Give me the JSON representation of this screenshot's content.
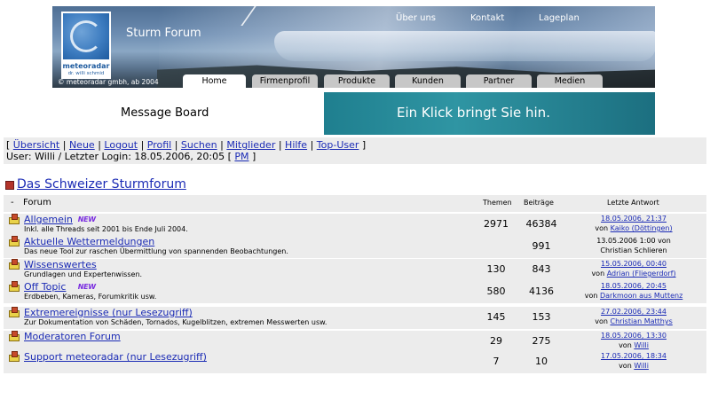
{
  "header": {
    "site_title": "Sturm Forum",
    "logo_name": "meteoradar",
    "logo_sub": "dr. willi schmid",
    "copyright": "© meteoradar gmbh, ab 2004",
    "top_links": [
      "Über uns",
      "Kontakt",
      "Lageplan"
    ],
    "tabs": [
      "Home",
      "Firmenprofil",
      "Produkte",
      "Kunden",
      "Partner",
      "Medien"
    ],
    "active_tab": "Home"
  },
  "subbanner": {
    "message_board": "Message Board",
    "ad_text": "Ein Klick bringt Sie hin."
  },
  "nav": {
    "links": [
      "Übersicht",
      "Neue",
      "Logout",
      "Profil",
      "Suchen",
      "Mitglieder",
      "Hilfe",
      "Top-User"
    ],
    "user_line": "User: Willi / Letzter Login: 18.05.2006, 20:05",
    "pm": "PM"
  },
  "forum": {
    "title": "Das Schweizer Sturmforum",
    "columns": {
      "minus": "-",
      "forum": "Forum",
      "themen": "Themen",
      "beitraege": "Beiträge",
      "letzte": "Letzte Antwort"
    },
    "new_badge": "NEW",
    "rows": [
      {
        "name": "Allgemein",
        "new": true,
        "desc": "Inkl. alle Threads seit 2001 bis Ende Juli 2004.",
        "themen": "2971",
        "beitraege": "46384",
        "last_date": "18.05.2006, 21:37",
        "last_date_link": true,
        "von": "von",
        "last_user": "Kaiko (Döttingen)",
        "last_user_link": true
      },
      {
        "name": "Aktuelle Wettermeldungen",
        "new": false,
        "desc": "Das neue Tool zur raschen Übermittlung von spannenden Beobachtungen.",
        "themen": "",
        "beitraege": "991",
        "last_date": "13.05.2006 1:00 von",
        "last_date_link": false,
        "von": "",
        "last_user": "Christian Schlieren",
        "last_user_link": false
      },
      {
        "name": "Wissenswertes",
        "new": false,
        "desc": "Grundlagen und Expertenwissen.",
        "themen": "130",
        "beitraege": "843",
        "last_date": "15.05.2006, 00:40",
        "last_date_link": true,
        "von": "von",
        "last_user": "Adrian (Fliegerdorf)",
        "last_user_link": true
      },
      {
        "name": "Off Topic",
        "new": true,
        "desc": "Erdbeben, Kameras, Forumkritik usw.",
        "themen": "580",
        "beitraege": "4136",
        "last_date": "18.05.2006, 20:45",
        "last_date_link": true,
        "von": "von",
        "last_user": "Darkmoon aus Muttenz",
        "last_user_link": true
      },
      {
        "name": "Extremereignisse (nur Lesezugriff)",
        "new": false,
        "desc": "Zur Dokumentation von Schäden, Tornados, Kugelblitzen, extremen Messwerten usw.",
        "themen": "145",
        "beitraege": "153",
        "last_date": "27.02.2006, 23:44",
        "last_date_link": true,
        "von": "von",
        "last_user": "Christian Matthys",
        "last_user_link": true
      },
      {
        "name": "Moderatoren Forum",
        "new": false,
        "desc": "",
        "themen": "29",
        "beitraege": "275",
        "last_date": "18.05.2006, 13:30",
        "last_date_link": true,
        "von": "von",
        "last_user": "Willi",
        "last_user_link": true
      },
      {
        "name": "Support meteoradar (nur Lesezugriff)",
        "new": false,
        "desc": "",
        "themen": "7",
        "beitraege": "10",
        "last_date": "17.05.2006, 18:34",
        "last_date_link": true,
        "von": "von",
        "last_user": "Willi",
        "last_user_link": true
      }
    ]
  },
  "colors": {
    "link": "#1b2bb5",
    "row_bg": "#ececec",
    "new_badge": "#7b2ee0",
    "ad_bg": "#2f95a3",
    "tab_bg": "#c7c7c7"
  },
  "icons": {
    "forum_title": "forum-category-icon",
    "row": "forum-folder-icon"
  }
}
